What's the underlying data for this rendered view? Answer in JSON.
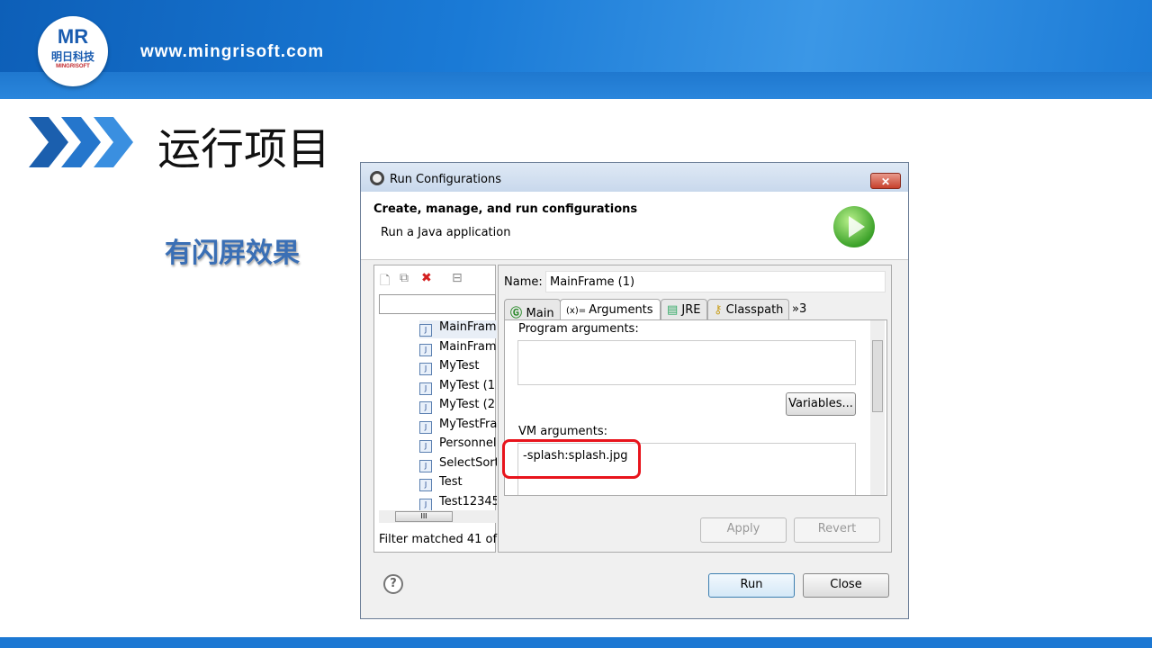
{
  "banner": {
    "logo_text": "MR",
    "logo_cn": "明日科技",
    "logo_en": "MINGRISOFT",
    "site": "www.mingrisoft.com"
  },
  "slide": {
    "title": "运行项目",
    "subtitle": "有闪屏效果"
  },
  "dialog": {
    "title": "Run Configurations",
    "header_title": "Create, manage, and run configurations",
    "header_sub": "Run a Java application",
    "tree_items": [
      "MainFram",
      "MainFram",
      "MyTest",
      "MyTest (1",
      "MyTest (2",
      "MyTestFra",
      "Personnel",
      "SelectSort",
      "Test",
      "Test12345"
    ],
    "filter_status": "Filter matched 41 of",
    "name_label": "Name:",
    "name_value": "MainFrame (1)",
    "tabs": [
      "Main",
      "Arguments",
      "JRE",
      "Classpath",
      "»3"
    ],
    "program_args_label": "Program arguments:",
    "program_args_value": "",
    "variables_button": "Variables...",
    "vm_args_label": "VM arguments:",
    "vm_args_value": "-splash:splash.jpg",
    "apply_button": "Apply",
    "revert_button": "Revert",
    "run_button": "Run",
    "close_button": "Close",
    "help": "?"
  },
  "colors": {
    "banner": "#1a7ad6",
    "highlight": "#e8141c",
    "title_blue": "#3a6fb5"
  }
}
